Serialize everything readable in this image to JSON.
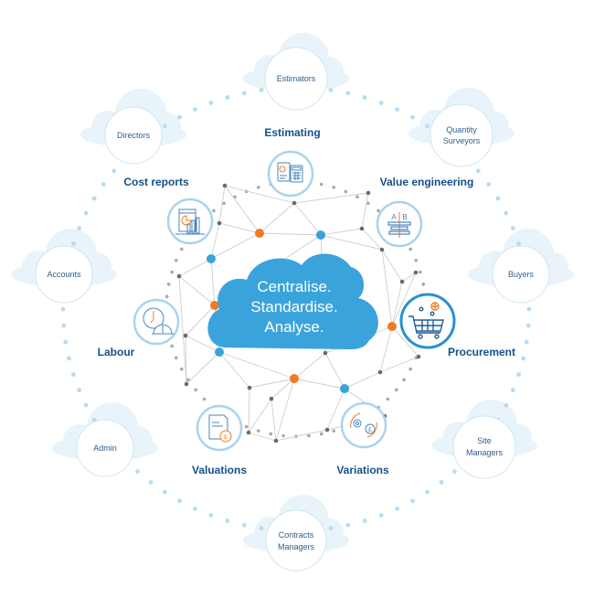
{
  "hub": {
    "lines": [
      "Centralise.",
      "Standardise.",
      "Analyse."
    ]
  },
  "colors": {
    "hub_blue": "#3aa3db",
    "label_navy": "#14518a",
    "role_text": "#2e5d88",
    "accent_orange": "#f07b22",
    "node_blue": "#3aa3db",
    "node_grey": "#6b6b6b",
    "icon_ring": "#a9d3ee",
    "icon_ring_active": "#2a8fd0",
    "cloud_fill": "#e4f1fa",
    "dot_blue": "#b6dcf1"
  },
  "roles": [
    {
      "id": "estimators",
      "lines": [
        "Estimators"
      ]
    },
    {
      "id": "quantity-surveyors",
      "lines": [
        "Quantity",
        "Surveyors"
      ]
    },
    {
      "id": "buyers",
      "lines": [
        "Buyers"
      ]
    },
    {
      "id": "site-managers",
      "lines": [
        "Site",
        "Managers"
      ]
    },
    {
      "id": "contracts-managers",
      "lines": [
        "Contracts",
        "Managers"
      ]
    },
    {
      "id": "admin",
      "lines": [
        "Admin"
      ]
    },
    {
      "id": "accounts",
      "lines": [
        "Accounts"
      ]
    },
    {
      "id": "directors",
      "lines": [
        "Directors"
      ]
    }
  ],
  "modules": [
    {
      "id": "estimating",
      "label": "Estimating",
      "icon": "calculator-document-icon",
      "active": false
    },
    {
      "id": "value-engineering",
      "label": "Value engineering",
      "icon": "ab-comparison-icon",
      "active": false
    },
    {
      "id": "procurement",
      "label": "Procurement",
      "icon": "shopping-cart-icon",
      "active": true
    },
    {
      "id": "variations",
      "label": "Variations",
      "icon": "gear-pound-cycle-icon",
      "active": false
    },
    {
      "id": "valuations",
      "label": "Valuations",
      "icon": "document-pound-icon",
      "active": false
    },
    {
      "id": "labour",
      "label": "Labour",
      "icon": "clock-hardhat-icon",
      "active": false
    },
    {
      "id": "cost-reports",
      "label": "Cost reports",
      "icon": "report-chart-icon",
      "active": false
    }
  ]
}
